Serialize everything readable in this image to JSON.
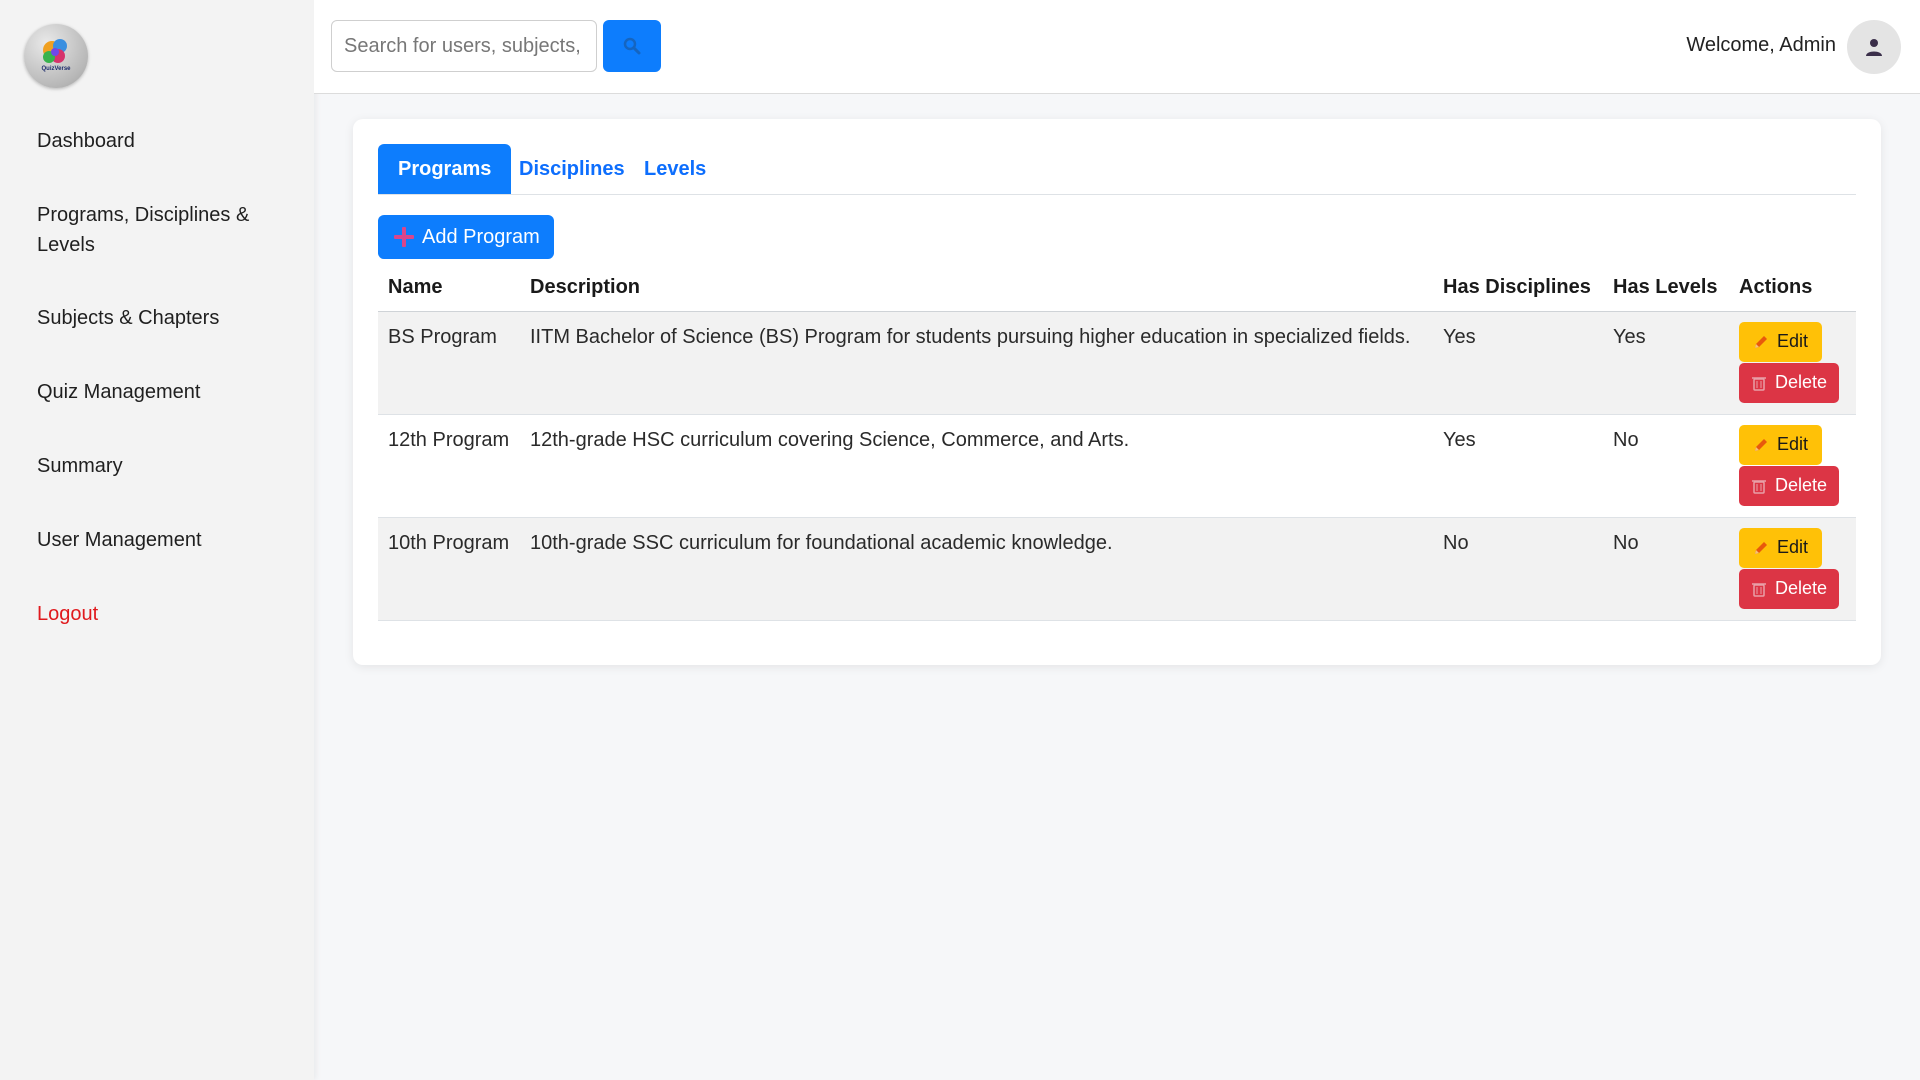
{
  "logo": {
    "text": "QuizVerse"
  },
  "sidebar": {
    "items": [
      {
        "label": "Dashboard"
      },
      {
        "label": "Programs, Disciplines & Levels"
      },
      {
        "label": "Subjects & Chapters"
      },
      {
        "label": "Quiz Management"
      },
      {
        "label": "Summary"
      },
      {
        "label": "User Management"
      }
    ],
    "logout": "Logout"
  },
  "header": {
    "search_placeholder": "Search for users, subjects, quizzes...",
    "search_icon": "search-icon",
    "welcome": "Welcome, Admin",
    "avatar_icon": "user-icon"
  },
  "tabs": [
    {
      "label": "Programs",
      "active": true
    },
    {
      "label": "Disciplines",
      "active": false
    },
    {
      "label": "Levels",
      "active": false
    }
  ],
  "add_button": {
    "label": "Add Program",
    "icon": "plus-icon"
  },
  "table": {
    "headers": [
      "Name",
      "Description",
      "Has Disciplines",
      "Has Levels",
      "Actions"
    ],
    "rows": [
      {
        "name": "BS Program",
        "description": "IITM Bachelor of Science (BS) Program for students pursuing higher education in specialized fields.",
        "has_disciplines": "Yes",
        "has_levels": "Yes"
      },
      {
        "name": "12th Program",
        "description": "12th-grade HSC curriculum covering Science, Commerce, and Arts.",
        "has_disciplines": "Yes",
        "has_levels": "No"
      },
      {
        "name": "10th Program",
        "description": "10th-grade SSC curriculum for foundational academic knowledge.",
        "has_disciplines": "No",
        "has_levels": "No"
      }
    ],
    "edit_label": "Edit",
    "delete_label": "Delete",
    "edit_icon": "pencil-icon",
    "delete_icon": "trash-icon"
  },
  "colors": {
    "primary": "#0d7dfd",
    "warning": "#ffc107",
    "danger": "#dc3545",
    "logout": "#e0191d"
  }
}
